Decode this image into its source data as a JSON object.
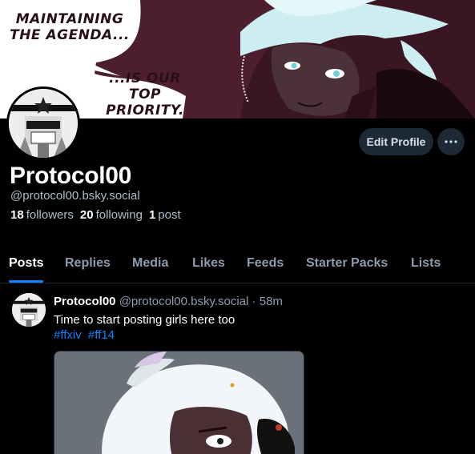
{
  "banner": {
    "bubble_text_1": "MAINTAINING THE AGENDA...",
    "bubble_text_2": "...IS OUR TOP PRIORITY."
  },
  "profile": {
    "display_name": "Protocol00",
    "handle": "@protocol00.bsky.social",
    "followers_count": "18",
    "followers_label": "followers",
    "following_count": "20",
    "following_label": "following",
    "posts_count": "1",
    "posts_label": "post"
  },
  "actions": {
    "edit_profile_label": "Edit Profile",
    "more_icon": "ellipsis-icon"
  },
  "tabs": [
    {
      "label": "Posts",
      "active": true
    },
    {
      "label": "Replies",
      "active": false
    },
    {
      "label": "Media",
      "active": false
    },
    {
      "label": "Likes",
      "active": false
    },
    {
      "label": "Feeds",
      "active": false
    },
    {
      "label": "Starter Packs",
      "active": false
    },
    {
      "label": "Lists",
      "active": false
    }
  ],
  "post": {
    "author_name": "Protocol00",
    "author_handle": "@protocol00.bsky.social",
    "separator": "·",
    "time": "58m",
    "text": "Time to start posting girls here too",
    "tags": [
      "#ffxiv",
      "#ff14"
    ]
  },
  "colors": {
    "background": "#000000",
    "accent": "#1083fe",
    "banner": "#4a1d2c",
    "button_bg": "#1e2936"
  }
}
